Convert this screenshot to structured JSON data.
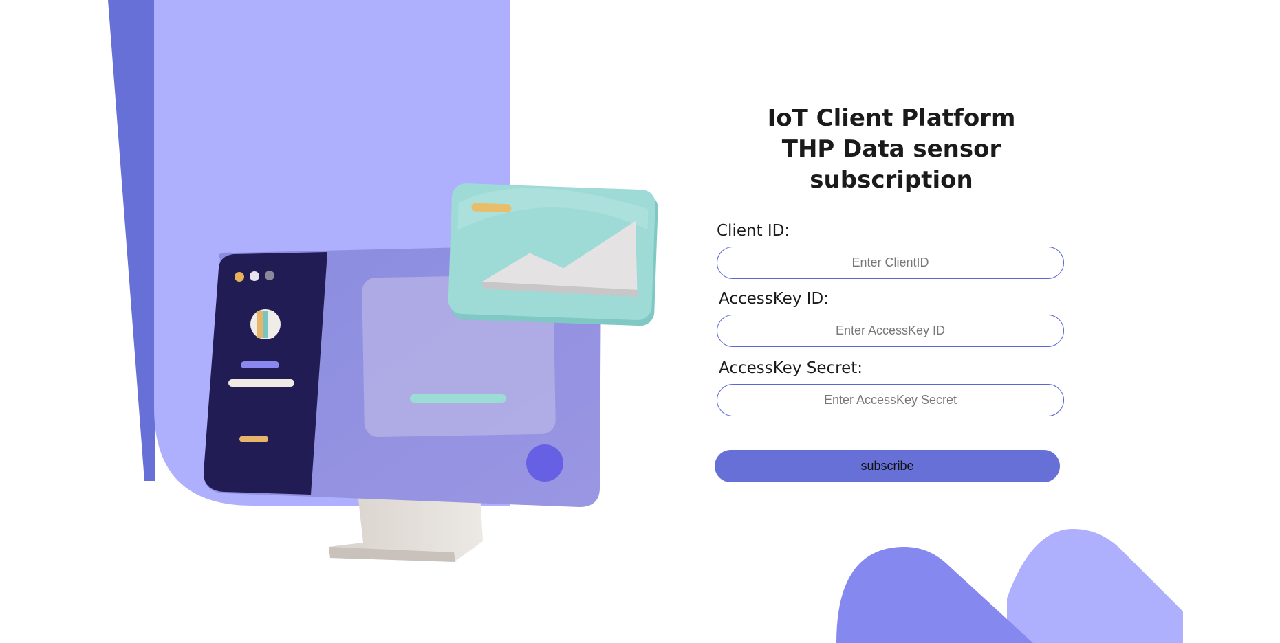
{
  "header": {
    "title_line1": "IoT Client Platform",
    "title_line2": "THP Data sensor subscription"
  },
  "form": {
    "client_id": {
      "label": "Client ID:",
      "placeholder": "Enter ClientID",
      "value": ""
    },
    "access_key_id": {
      "label": "AccessKey ID:",
      "placeholder": "Enter AccessKey ID",
      "value": ""
    },
    "access_key_secret": {
      "label": "AccessKey Secret:",
      "placeholder": "Enter AccessKey Secret",
      "value": ""
    },
    "subscribe_label": "subscribe"
  },
  "colors": {
    "accent": "#6670d6",
    "panel_light": "#aeb0fd",
    "panel_dark": "#6670d6",
    "teal": "#8fd6d2",
    "screen_dark": "#221c55"
  },
  "illustration": {
    "icon": "desktop-monitor-illustration"
  }
}
